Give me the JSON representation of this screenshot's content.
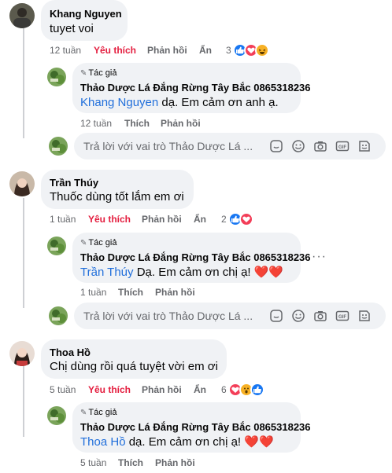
{
  "comments": [
    {
      "author": "Khang Nguyen",
      "text": "tuyet voi",
      "time": "12 tuần",
      "like": "Yêu thích",
      "reply": "Phản hồi",
      "hide": "Ẩn",
      "reaction_count": "3",
      "reactions": [
        "like",
        "love",
        "haha"
      ],
      "page_reply": {
        "badge": "Tác giả",
        "author": "Thảo Dược Lá Đắng Rừng Tây Bắc 0865318236",
        "mention": "Khang Nguyen",
        "text": " dạ. Em cảm ơn anh ạ.",
        "time": "12 tuần",
        "like": "Thích",
        "reply": "Phản hồi"
      },
      "reply_box_placeholder": "Trả lời với vai trò Thảo Dược Lá ..."
    },
    {
      "author": "Trần Thúy",
      "text": "Thuốc dùng tốt lắm em ơi",
      "time": "1 tuần",
      "like": "Yêu thích",
      "reply": "Phản hồi",
      "hide": "Ẩn",
      "reaction_count": "2",
      "reactions": [
        "like",
        "love"
      ],
      "page_reply": {
        "badge": "Tác giả",
        "author": "Thảo Dược Lá Đắng Rừng Tây Bắc 0865318236",
        "mention": "Trần Thúy",
        "text": " Dạ. Em cảm ơn chị ạ! ❤️❤️",
        "time": "1 tuần",
        "like": "Thích",
        "reply": "Phản hồi",
        "more": "···"
      },
      "reply_box_placeholder": "Trả lời với vai trò Thảo Dược Lá ..."
    },
    {
      "author": "Thoa Hồ",
      "text": "Chị dùng rồi quá tuyệt vời em ơi",
      "time": "5 tuần",
      "like": "Yêu thích",
      "reply": "Phản hồi",
      "hide": "Ẩn",
      "reaction_count": "6",
      "reactions": [
        "love",
        "wow",
        "like"
      ],
      "page_reply": {
        "badge": "Tác giả",
        "author": "Thảo Dược Lá Đắng Rừng Tây Bắc 0865318236",
        "mention": "Thoa Hồ",
        "text": " dạ. Em cảm ơn chị ạ! ❤️❤️",
        "time": "5 tuần",
        "like": "Thích",
        "reply": "Phản hồi"
      }
    }
  ],
  "colors": {
    "bubble": "#f0f2f5",
    "liked": "#e41e3f",
    "mention": "#216fdb",
    "like_reaction": "#1877f2",
    "love_reaction": "#f33e58",
    "haha_reaction": "#f7b125"
  },
  "toolbar_icons": [
    "sticker-icon",
    "emoji-icon",
    "camera-icon",
    "gif-icon",
    "avatar-sticker-icon"
  ]
}
